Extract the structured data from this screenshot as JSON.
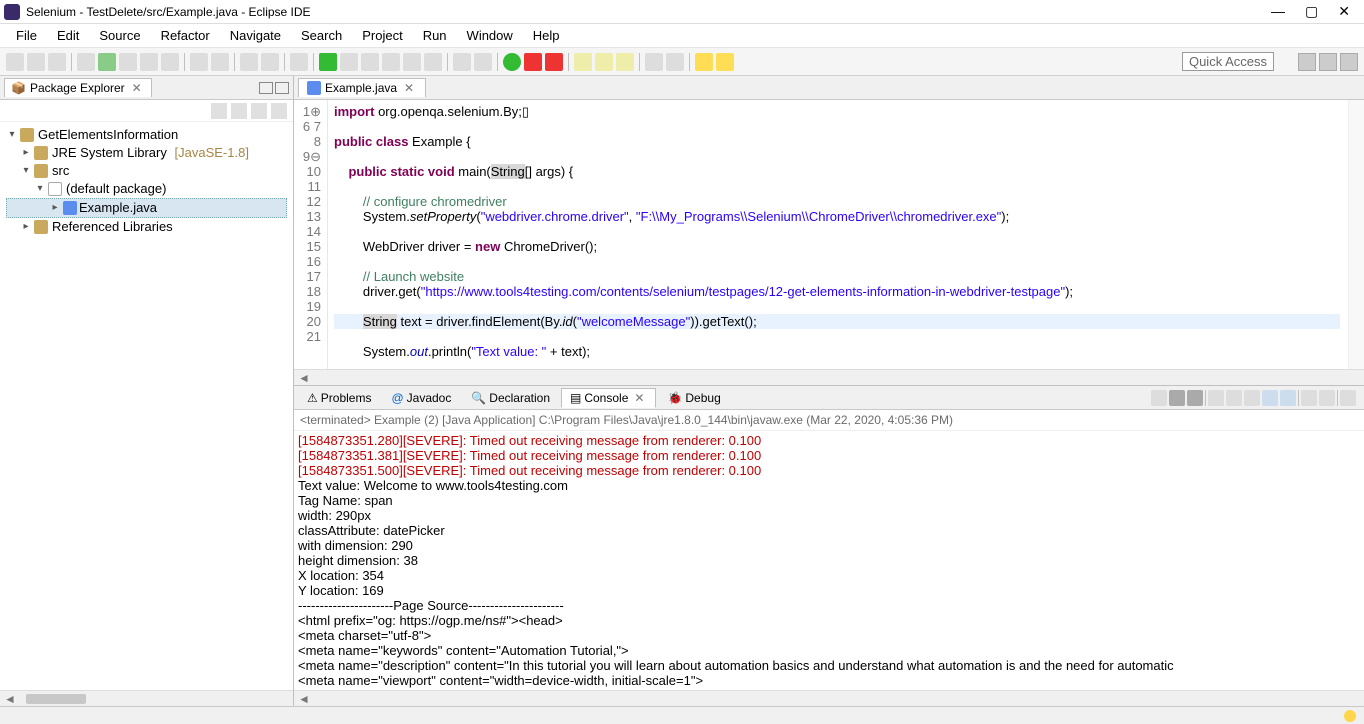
{
  "title": "Selenium - TestDelete/src/Example.java - Eclipse IDE",
  "menu": [
    "File",
    "Edit",
    "Source",
    "Refactor",
    "Navigate",
    "Search",
    "Project",
    "Run",
    "Window",
    "Help"
  ],
  "quick_access": "Quick Access",
  "package_explorer": {
    "title": "Package Explorer",
    "root": "GetElementsInformation",
    "jre": "JRE System Library",
    "jre_ver": "[JavaSE-1.8]",
    "src": "src",
    "pkg": "(default package)",
    "file": "Example.java",
    "reflib": "Referenced Libraries"
  },
  "editor": {
    "tab": "Example.java",
    "lines": [
      "1",
      "6",
      "7",
      "8",
      "9",
      "10",
      "11",
      "12",
      "13",
      "14",
      "15",
      "16",
      "17",
      "18",
      "19",
      "20",
      "21"
    ]
  },
  "code": {
    "l1a": "import",
    "l1b": " org.openqa.selenium.By;",
    "l3a": "public class",
    "l3b": " Example {",
    "l5a": "public static void",
    "l5b": " main(",
    "l5c": "String",
    "l5d": "[] args) {",
    "l7": "// configure chromedriver",
    "l8a": "System.",
    "l8b": "setProperty",
    "l8c": "(",
    "l8d": "\"webdriver.chrome.driver\"",
    "l8e": ", ",
    "l8f": "\"F:\\\\My_Programs\\\\Selenium\\\\ChromeDriver\\\\chromedriver.exe\"",
    "l8g": ");",
    "l10a": "WebDriver ",
    "l10b": "driver",
    "l10c": " = ",
    "l10d": "new",
    "l10e": " ChromeDriver();",
    "l12": "// Launch website",
    "l13a": "driver",
    ".l13": "",
    "l13b": ".get(",
    "l13c": "\"https://www.tools4testing.com/contents/selenium/testpages/12-get-elements-information-in-webdriver-testpage\"",
    "l13d": ");",
    "l15a": "String",
    "l15b": " text = ",
    "l15c": "driver",
    "l15d": ".findElement(By.",
    "l15e": "id",
    "l15f": "(",
    "l15g": "\"welcomeMessage\"",
    "l15h": ")).getText();",
    "l16a": "System.",
    "l16b": "out",
    "l16c": ".println(",
    "l16d": "\"Text value: \"",
    "l16e": " + text);"
  },
  "btabs": {
    "problems": "Problems",
    "javadoc": "Javadoc",
    "declaration": "Declaration",
    "console": "Console",
    "debug": "Debug"
  },
  "console_head": "<terminated> Example (2) [Java Application] C:\\Program Files\\Java\\jre1.8.0_144\\bin\\javaw.exe (Mar 22, 2020, 4:05:36 PM)",
  "console_lines": [
    {
      "t": "[1584873351.280][SEVERE]: Timed out receiving message from renderer: 0.100",
      "err": true
    },
    {
      "t": "[1584873351.381][SEVERE]: Timed out receiving message from renderer: 0.100",
      "err": true
    },
    {
      "t": "[1584873351.500][SEVERE]: Timed out receiving message from renderer: 0.100",
      "err": true
    },
    {
      "t": "Text value: Welcome to www.tools4testing.com"
    },
    {
      "t": "Tag Name: span"
    },
    {
      "t": "width: 290px"
    },
    {
      "t": "classAttribute: datePicker"
    },
    {
      "t": "with dimension: 290"
    },
    {
      "t": "height dimension: 38"
    },
    {
      "t": "X location: 354"
    },
    {
      "t": "Y location: 169"
    },
    {
      "t": "----------------------Page Source----------------------"
    },
    {
      "t": "<html prefix=\"og: https://ogp.me/ns#\"><head>"
    },
    {
      "t": "<meta charset=\"utf-8\">"
    },
    {
      "t": "<meta name=\"keywords\" content=\"Automation Tutorial,\">"
    },
    {
      "t": "<meta name=\"description\" content=\"In this tutorial you will learn about automation basics and understand what automation is and the need for automatic"
    },
    {
      "t": "<meta name=\"viewport\" content=\"width=device-width, initial-scale=1\">"
    }
  ]
}
